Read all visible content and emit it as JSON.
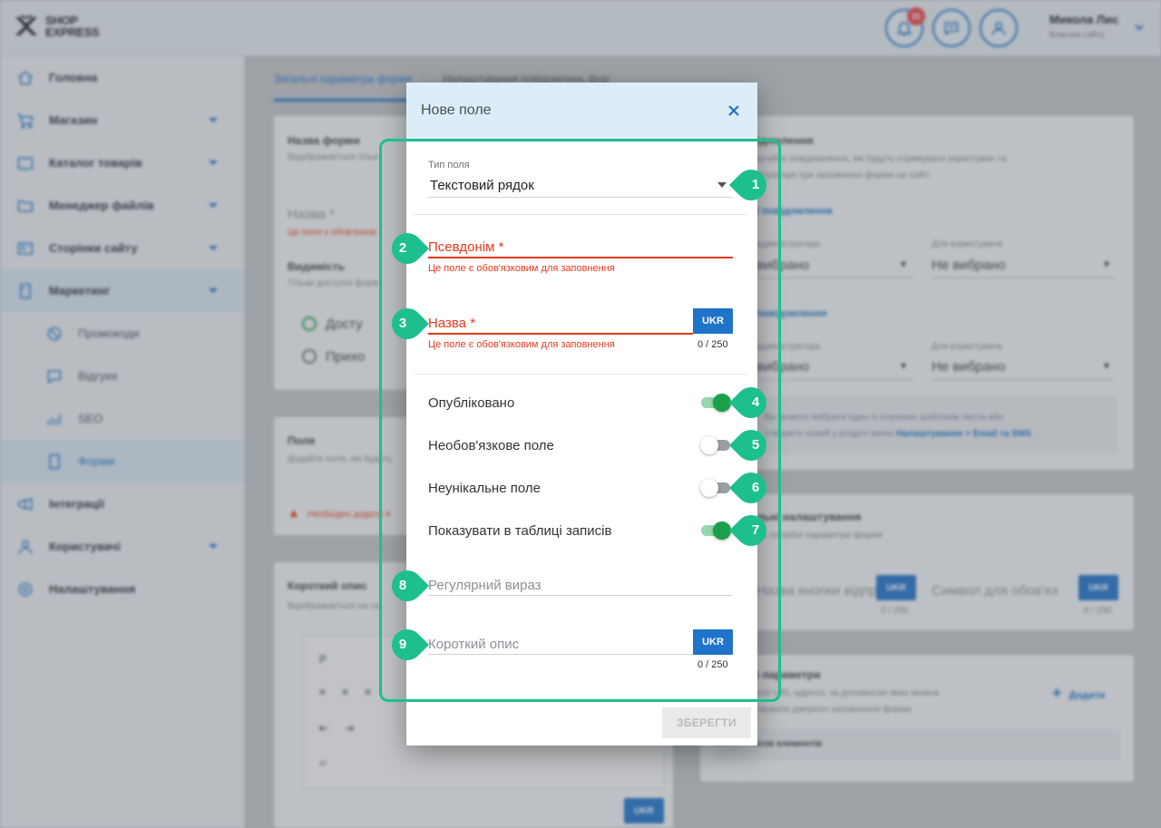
{
  "app": {
    "logo": {
      "line1": "SHOP",
      "line2": "EXPRESS"
    },
    "notifications_count": "31",
    "user": {
      "name": "Микола Лис",
      "role": "Власник сайту"
    },
    "sidebar": [
      {
        "label": "Головна",
        "icon": "home-icon",
        "caret": false
      },
      {
        "label": "Магазин",
        "icon": "cart-icon",
        "caret": true
      },
      {
        "label": "Каталог товарів",
        "icon": "book-icon",
        "caret": true
      },
      {
        "label": "Менеджер файлів",
        "icon": "folder-icon",
        "caret": true
      },
      {
        "label": "Сторінки сайту",
        "icon": "pages-icon",
        "caret": true
      },
      {
        "label": "Маркетинг",
        "icon": "marketing-icon",
        "caret": true,
        "active": true
      },
      {
        "label": "Промокоди",
        "icon": "promo-icon",
        "sub": true
      },
      {
        "label": "Відгуки",
        "icon": "reviews-icon",
        "sub": true
      },
      {
        "label": "SEO",
        "icon": "seo-icon",
        "sub": true
      },
      {
        "label": "Форми",
        "icon": "forms-icon",
        "sub": true,
        "active": true
      },
      {
        "label": "Інтеграції",
        "icon": "integrations-icon",
        "caret": false
      },
      {
        "label": "Користувачі",
        "icon": "users-icon",
        "caret": true
      },
      {
        "label": "Налаштування",
        "icon": "settings-icon",
        "caret": false
      }
    ],
    "tabs": [
      "Загальні параметри форми",
      "Налаштування повідомлень фор"
    ],
    "left_column": {
      "form_name_title": "Назва форми",
      "form_name_hint": "Відображається тільк",
      "name_placeholder": "Назва *",
      "name_error": "Це поле є обов'язков",
      "visibility_title": "Видимість",
      "visibility_hint": "Тільки доступні форм",
      "radio_available": "Досту",
      "radio_hidden": "Прихо",
      "fields_title": "Поля",
      "fields_hint": "Додайте поля, які будуть",
      "fields_warning": "Необхідно додати я",
      "short_desc_title": "Короткий опис",
      "short_desc_hint": "Відображається на са",
      "editor_p": "P",
      "editor_ukr": "UKR"
    },
    "right_column": {
      "notif_title": "ідомлення",
      "notif_hint1": "штуйте повідомлення, які будуть отримувати користувач та",
      "notif_hint2": "істратори при заповненні форми на сайті",
      "email_link": "l повідомлення",
      "admin_label": "адміністратора",
      "user_label": "Для користувача",
      "admin_value": "вибрано",
      "user_value": "Не вибрано",
      "sms_link": "повідомлення",
      "admin_label2": "адміністратора",
      "user_label2": "Для користувача",
      "admin_value2": "вибрано",
      "user_value2": "Не вибрано",
      "info1": "Ви можете вибрати один із існуючих шаблонів листа або",
      "info2": "створити новий у розділі меню",
      "info_link": "Налаштування > Email та SMS",
      "extra_title": "льні налаштування",
      "extra_hint": "іть потрібні параметри форми",
      "button_text_placeholder": "Назва кнопки відпр",
      "required_symbol_placeholder": "Символ для обов'яз",
      "counter_a": "0 / 250",
      "counter_b": "0 / 250",
      "ukr": "UKR",
      "params_title": "і параметри",
      "params_hint1": "ите URL-адреси, за допомогою яких можна",
      "params_hint2": "овувати джерело заповнення форми",
      "add_label": "Додати",
      "list_label": "ісок елементів"
    }
  },
  "modal": {
    "title": "Нове поле",
    "field_type_label": "Тип поля",
    "field_type_value": "Текстовий рядок",
    "alias_label": "Псевдонім *",
    "alias_error": "Це поле є обов'язковим для заповнення",
    "name_label": "Назва *",
    "name_error": "Це поле є обов'язковим для заповнення",
    "name_counter": "0 / 250",
    "ukr": "UKR",
    "toggles": [
      {
        "label": "Опубліковано",
        "on": true
      },
      {
        "label": "Необов'язкове поле",
        "on": false
      },
      {
        "label": "Неунікальне поле",
        "on": false
      },
      {
        "label": "Показувати в таблиці записів",
        "on": true
      }
    ],
    "regex_placeholder": "Регулярний вираз",
    "short_desc_placeholder": "Короткий опис",
    "short_desc_counter": "0 / 250",
    "save_label": "ЗБЕРЕГТИ"
  },
  "markers": [
    "1",
    "2",
    "3",
    "4",
    "5",
    "6",
    "7",
    "8",
    "9"
  ],
  "colors": {
    "accent": "#1f73c9",
    "error": "#e5391c",
    "toggle_on": "#1aa04b",
    "annotation": "#1dbf8e",
    "modal_header": "#dcedf8"
  }
}
